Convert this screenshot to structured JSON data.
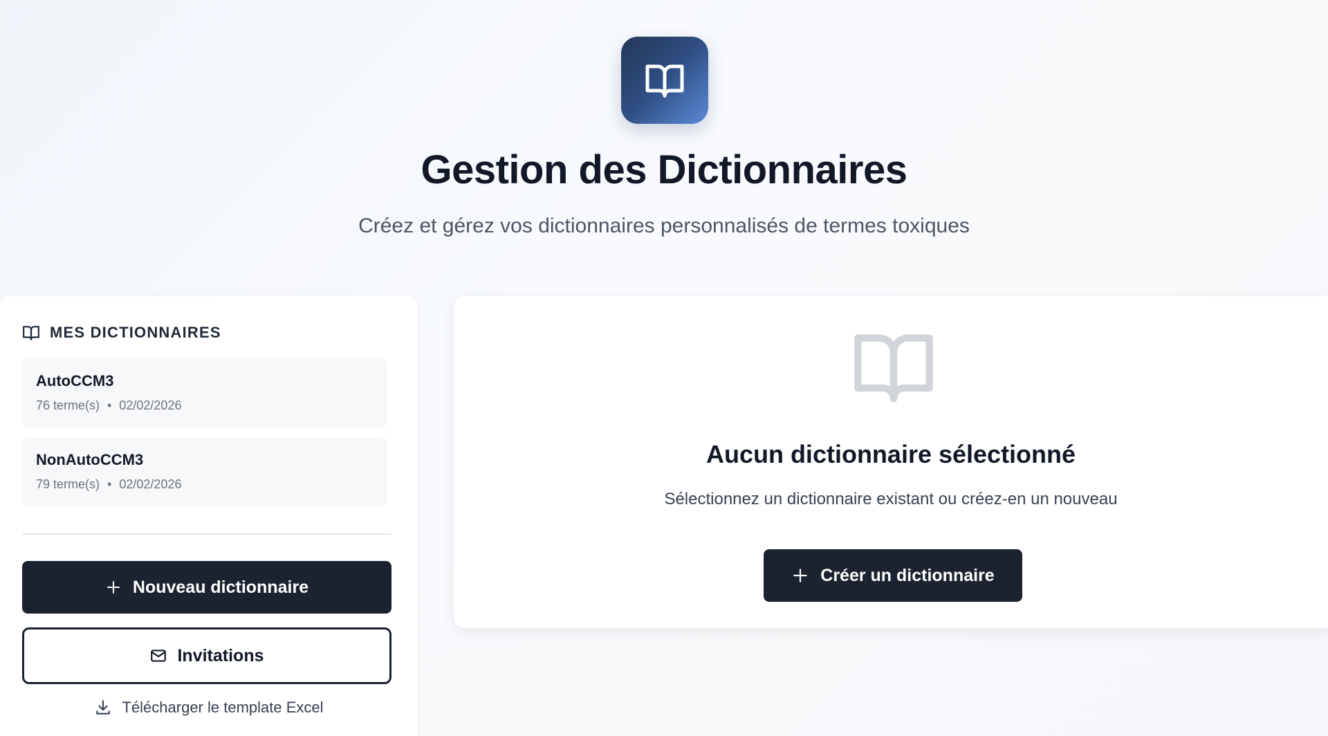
{
  "header": {
    "title": "Gestion des Dictionnaires",
    "subtitle": "Créez et gérez vos dictionnaires personnalisés de termes toxiques",
    "logo_icon": "book-open-icon",
    "logo_gradient": [
      "#243757",
      "#5b8ad6"
    ]
  },
  "sidebar": {
    "heading": "MES DICTIONNAIRES",
    "heading_icon": "book-open-icon",
    "dictionaries": [
      {
        "name": "AutoCCM3",
        "terms": "76 terme(s)",
        "date": "02/02/2026"
      },
      {
        "name": "NonAutoCCM3",
        "terms": "79 terme(s)",
        "date": "02/02/2026"
      }
    ],
    "meta_separator": "•",
    "new_button_label": "Nouveau dictionnaire",
    "invitations_button_label": "Invitations",
    "download_link_label": "Télécharger le template Excel"
  },
  "main": {
    "empty_icon": "book-open-icon",
    "empty_title": "Aucun dictionnaire sélectionné",
    "empty_text": "Sélectionnez un dictionnaire existant ou créez-en un nouveau",
    "create_button_label": "Créer un dictionnaire"
  },
  "colors": {
    "primary_button": "#1b2331",
    "text_dark": "#111827",
    "text_muted": "#6b7280",
    "empty_icon": "#d1d5db"
  }
}
